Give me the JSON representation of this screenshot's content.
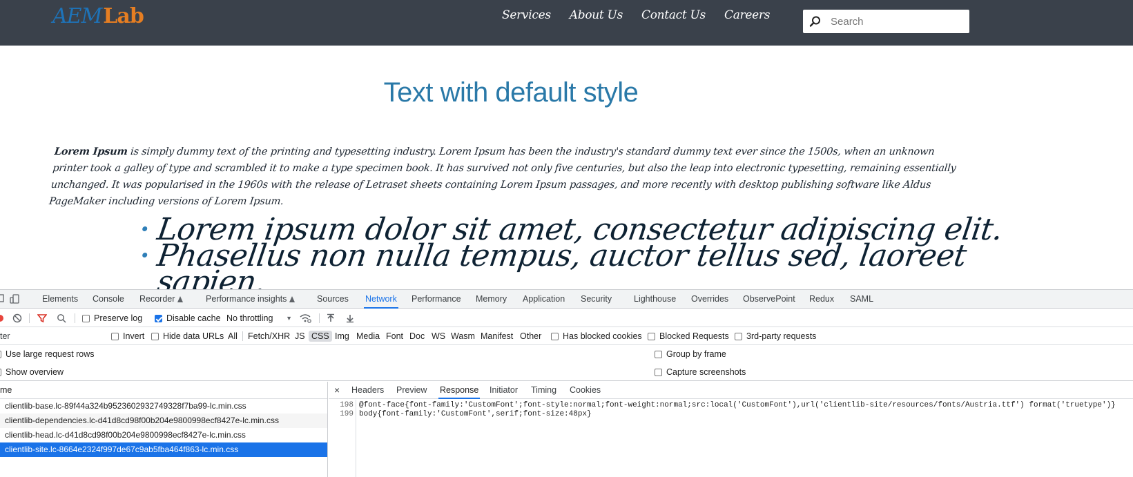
{
  "site": {
    "logo_part1": "AEM",
    "logo_part2": "Lab",
    "nav": [
      "Services",
      "About Us",
      "Contact Us",
      "Careers"
    ],
    "search_placeholder": "Search",
    "page_title": "Text with default style",
    "paragraph_lead": "Lorem Ipsum",
    "paragraph_rest": " is simply dummy text of the printing and typesetting industry. Lorem Ipsum has been the industry's standard dummy text ever since the 1500s, when an unknown printer took a galley of type and scrambled it to make a type specimen book. It has survived not only five centuries, but also the leap into electronic typesetting, remaining essentially unchanged. It was popularised in the 1960s with the release of Letraset sheets containing Lorem Ipsum passages, and more recently with desktop publishing software like Aldus PageMaker including versions of Lorem Ipsum.",
    "bullets": [
      "Lorem ipsum dolor sit amet, consectetur adipiscing elit.",
      "Phasellus non nulla tempus, auctor tellus sed, laoreet",
      "sapien."
    ]
  },
  "devtools": {
    "tabs": [
      "Elements",
      "Console",
      "Recorder",
      "Performance insights",
      "Sources",
      "Network",
      "Performance",
      "Memory",
      "Application",
      "Security",
      "Lighthouse",
      "Overrides",
      "ObservePoint",
      "Redux",
      "SAML"
    ],
    "active_tab": "Network",
    "toolbar": {
      "preserve_log": "Preserve log",
      "disable_cache": "Disable cache",
      "throttling": "No throttling"
    },
    "filter": {
      "placeholder": "ter",
      "invert": "Invert",
      "hide_data_urls": "Hide data URLs",
      "types": [
        "All",
        "Fetch/XHR",
        "JS",
        "CSS",
        "Img",
        "Media",
        "Font",
        "Doc",
        "WS",
        "Wasm",
        "Manifest",
        "Other"
      ],
      "selected_type": "CSS",
      "has_blocked_cookies": "Has blocked cookies",
      "blocked_requests": "Blocked Requests",
      "third_party": "3rd-party requests"
    },
    "options": {
      "large_rows": "Use large request rows",
      "group_by_frame": "Group by frame",
      "show_overview": "Show overview",
      "capture_screenshots": "Capture screenshots"
    },
    "requests_header": "me",
    "requests": [
      "clientlib-base.lc-89f44a324b9523602932749328f7ba99-lc.min.css",
      "clientlib-dependencies.lc-d41d8cd98f00b204e9800998ecf8427e-lc.min.css",
      "clientlib-head.lc-d41d8cd98f00b204e9800998ecf8427e-lc.min.css",
      "clientlib-site.lc-8664e2324f997de67c9ab5fba464f863-lc.min.css"
    ],
    "selected_request": 3,
    "detail_tabs": [
      "Headers",
      "Preview",
      "Response",
      "Initiator",
      "Timing",
      "Cookies"
    ],
    "active_detail_tab": "Response",
    "code_lines": [
      {
        "num": "198",
        "text": "@font-face{font-family:'CustomFont';font-style:normal;font-weight:normal;src:local('CustomFont'),url('clientlib-site/resources/fonts/Austria.ttf') format('truetype')}"
      },
      {
        "num": "199",
        "text": "body{font-family:'CustomFont',serif;font-size:48px}"
      }
    ]
  }
}
